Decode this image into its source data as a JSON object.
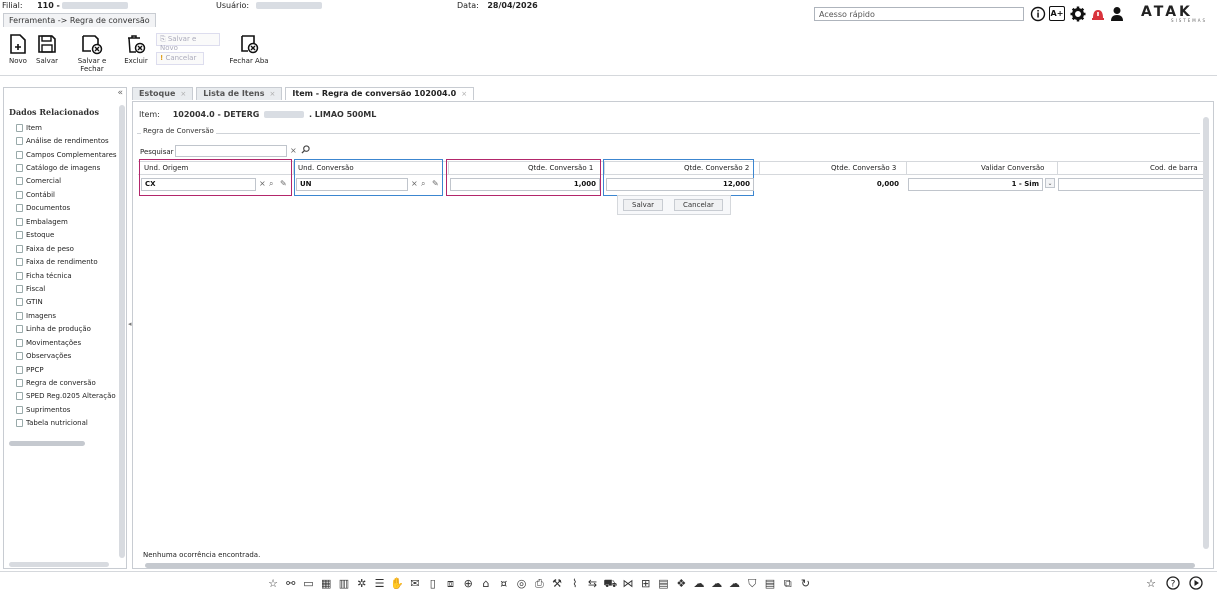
{
  "header": {
    "filial_label": "Filial:",
    "filial_value": "110 -",
    "usuario_label": "Usuário:",
    "data_label": "Data:",
    "data_value": "28/04/2026",
    "app_tab": "Ferramenta -> Regra de conversão",
    "quick_access_placeholder": "Acesso rápido",
    "logo_text": "ATAK",
    "logo_sub": "SISTEMAS",
    "font_plus": "A+"
  },
  "toolbar": {
    "novo": "Novo",
    "salvar": "Salvar",
    "salvar_fechar": "Salvar e Fechar",
    "excluir": "Excluir",
    "salvar_novo": "Salvar e Novo",
    "cancelar": "Cancelar",
    "fechar_aba": "Fechar Aba"
  },
  "left_panel": {
    "title": "Dados Relacionados",
    "collapse": "«",
    "items": [
      "Item",
      "Análise de rendimentos",
      "Campos Complementares",
      "Catálogo de imagens",
      "Comercial",
      "Contábil",
      "Documentos",
      "Embalagem",
      "Estoque",
      "Faixa de peso",
      "Faixa de rendimento",
      "Ficha técnica",
      "Fiscal",
      "GTIN",
      "Imagens",
      "Linha de produção",
      "Movimentações",
      "Observações",
      "PPCP",
      "Regra de conversão",
      "SPED Reg.0205 Alteração",
      "Suprimentos",
      "Tabela nutricional"
    ]
  },
  "tabs": [
    {
      "label": "Estoque",
      "active": false
    },
    {
      "label": "Lista de Itens",
      "active": false
    },
    {
      "label": "Item - Regra de conversão 102004.0",
      "active": true
    }
  ],
  "main": {
    "item_label": "Item:",
    "item_code": "102004.0 - DETERG",
    "item_name": ". LIMAO 500ML",
    "legend": "Regra de Conversão",
    "search_label": "Pesquisar",
    "columns": {
      "und_origem": "Und. Origem",
      "und_conversao": "Und. Conversão",
      "qtde1": "Qtde. Conversão 1",
      "qtde2": "Qtde. Conversão 2",
      "qtde3": "Qtde. Conversão 3",
      "validar": "Validar Conversão",
      "cod_barra": "Cod. de barra"
    },
    "row": {
      "und_origem": "CX",
      "und_conversao": "UN",
      "qtde1": "1,000",
      "qtde2": "12,000",
      "qtde3": "0,000",
      "validar": "1 - Sim"
    },
    "edit_save": "Salvar",
    "edit_cancel": "Cancelar",
    "footer": "Nenhuma ocorrência encontrada."
  },
  "colors": {
    "highlight_origin": "#b3266b",
    "highlight_conversion": "#3c86d0"
  }
}
